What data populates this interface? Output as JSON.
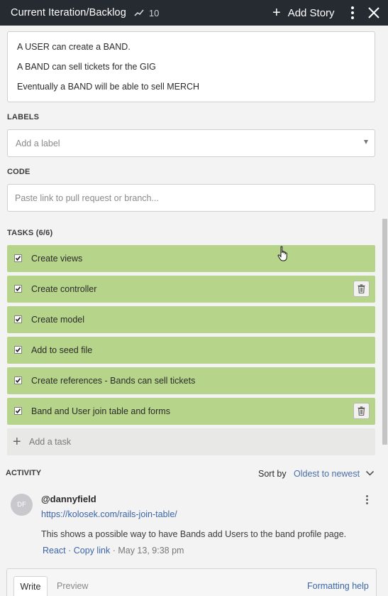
{
  "header": {
    "title": "Current Iteration/Backlog",
    "points": "10",
    "add_story_label": "Add Story"
  },
  "description": {
    "lines": [
      "A USER can create a BAND.",
      "A BAND can sell tickets for the GIG",
      "Eventually a BAND will be able to sell MERCH"
    ]
  },
  "labels": {
    "heading": "LABELS",
    "placeholder": "Add a label"
  },
  "code": {
    "heading": "CODE",
    "placeholder": "Paste link to pull request or branch..."
  },
  "tasks": {
    "heading": "TASKS (6/6)",
    "items": [
      {
        "label": "Create views",
        "checked": true
      },
      {
        "label": "Create controller",
        "checked": true
      },
      {
        "label": "Create model",
        "checked": true
      },
      {
        "label": "Add to seed file",
        "checked": true
      },
      {
        "label": "Create references - Bands can sell tickets",
        "checked": true
      },
      {
        "label": "Band and User join table and forms",
        "checked": true
      }
    ],
    "add_label": "Add a task"
  },
  "activity": {
    "heading": "ACTIVITY",
    "sort_label": "Sort by",
    "sort_value": "Oldest to newest",
    "comment": {
      "avatar_initials": "DF",
      "username": "@dannyfield",
      "link": "https://kolosek.com/rails-join-table/",
      "text": "This shows a possible way to have Bands add Users to the band profile page.",
      "react_label": "React",
      "copy_link_label": "Copy link",
      "timestamp": "May 13, 9:38 pm"
    }
  },
  "editor": {
    "write_tab": "Write",
    "preview_tab": "Preview",
    "formatting_help": "Formatting help"
  },
  "colors": {
    "header_bg": "#262b31",
    "task_bg": "#b6d48a",
    "link": "#3b65a6"
  }
}
